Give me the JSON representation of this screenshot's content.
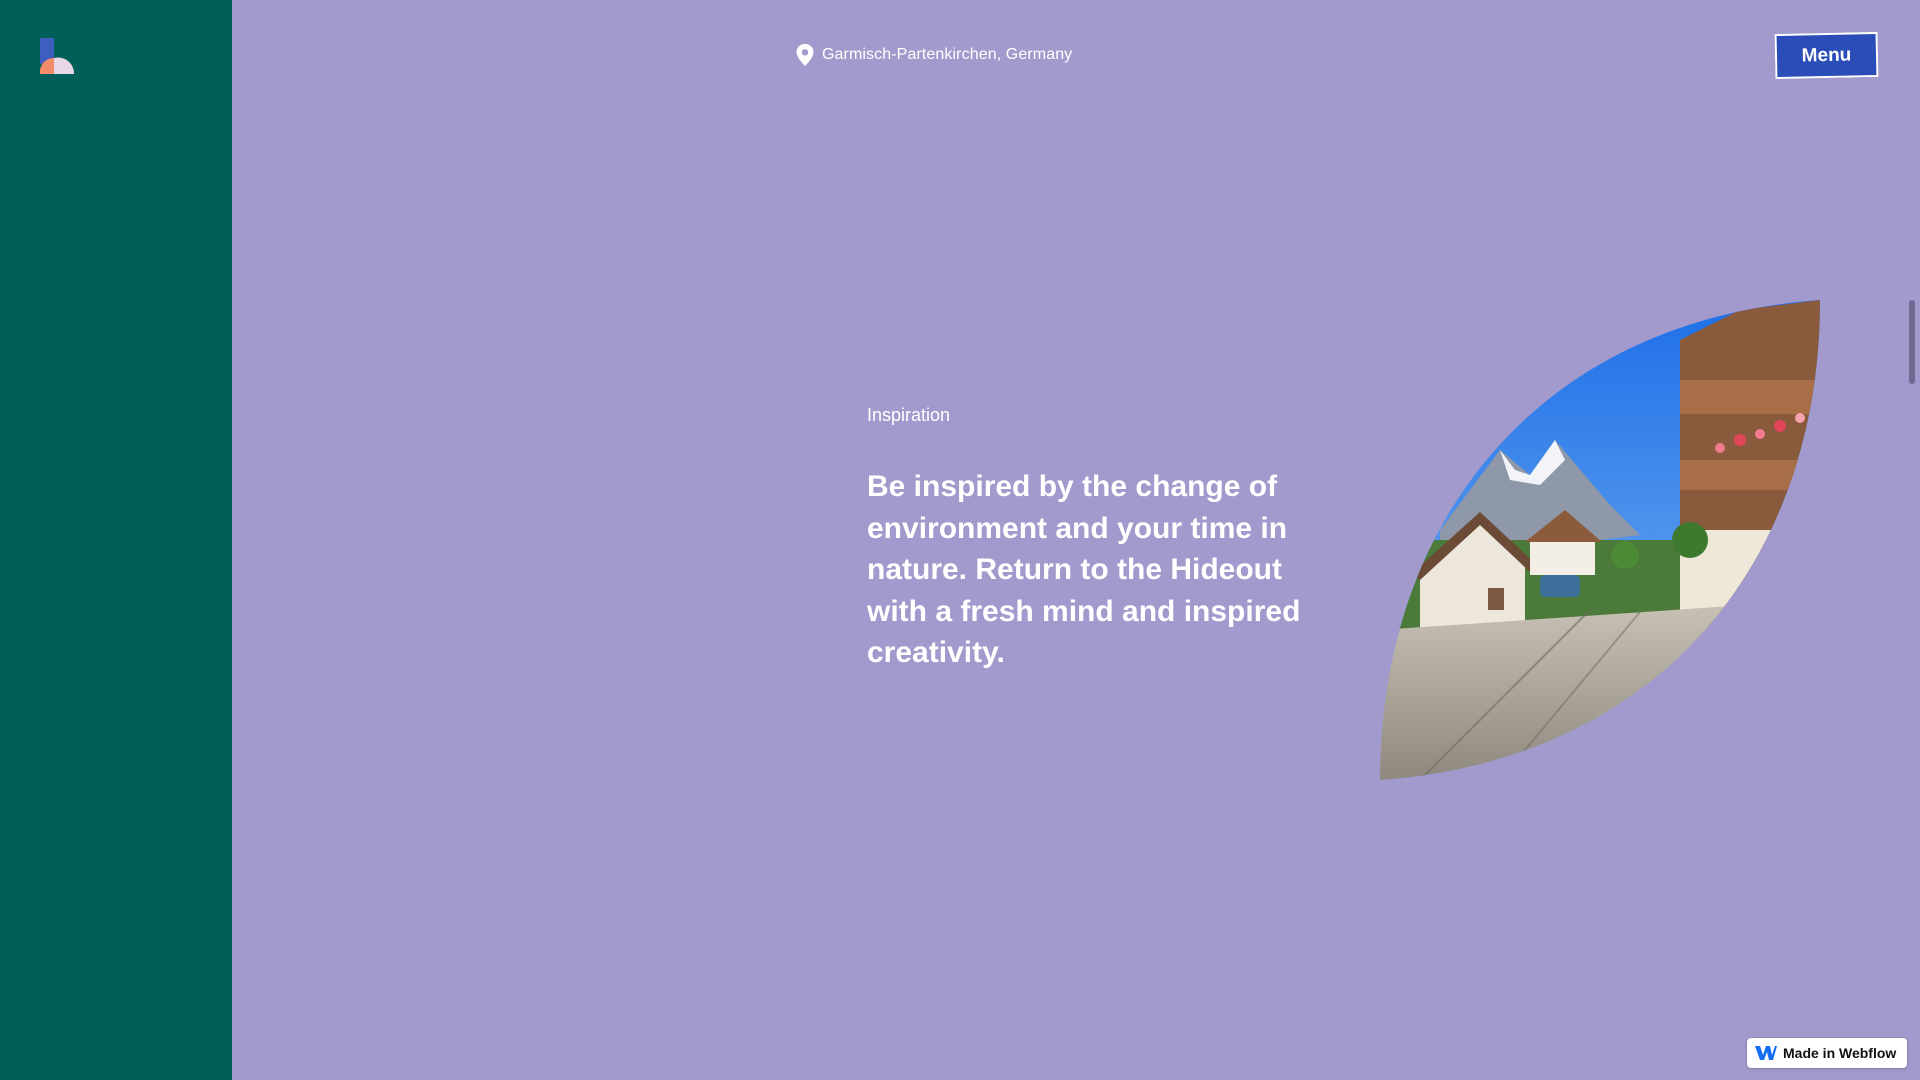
{
  "header": {
    "location": "Garmisch-Partenkirchen, Germany",
    "menu_label": "Menu"
  },
  "main": {
    "section_label": "Inspiration",
    "headline": "Be inspired by the change of environment and your time in nature. Return to the Hideout with a fresh mind and inspired creativity."
  },
  "badge": {
    "label": "Made in Webflow"
  },
  "icons": {
    "logo": "hideout-logo",
    "location": "map-pin-icon",
    "badge": "webflow-icon"
  },
  "colors": {
    "background": "#A29ACC",
    "sidebar": "#005F59",
    "menu_button": "#2B4DB8",
    "text": "#FFFFFF"
  }
}
